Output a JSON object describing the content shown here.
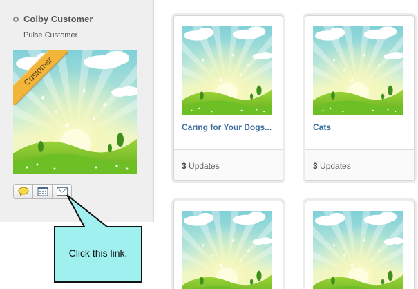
{
  "user": {
    "name": "Colby Customer",
    "role": "Pulse Customer",
    "badge": "Customer"
  },
  "action_bar": {
    "buttons": [
      {
        "icon": "speech-bubble-icon"
      },
      {
        "icon": "calendar-icon"
      },
      {
        "icon": "envelope-icon"
      }
    ]
  },
  "cards": [
    {
      "title": "Caring for Your Dogs...",
      "count": "3",
      "count_label": "Updates"
    },
    {
      "title": "Cats",
      "count": "3",
      "count_label": "Updates"
    },
    {
      "title": "",
      "count": "",
      "count_label": ""
    },
    {
      "title": "",
      "count": "",
      "count_label": ""
    }
  ],
  "callout": {
    "text": "Click this link."
  },
  "colors": {
    "link": "#3f6fa0",
    "callout_fill": "#9ff0ef",
    "ribbon": "#f2b53a"
  }
}
